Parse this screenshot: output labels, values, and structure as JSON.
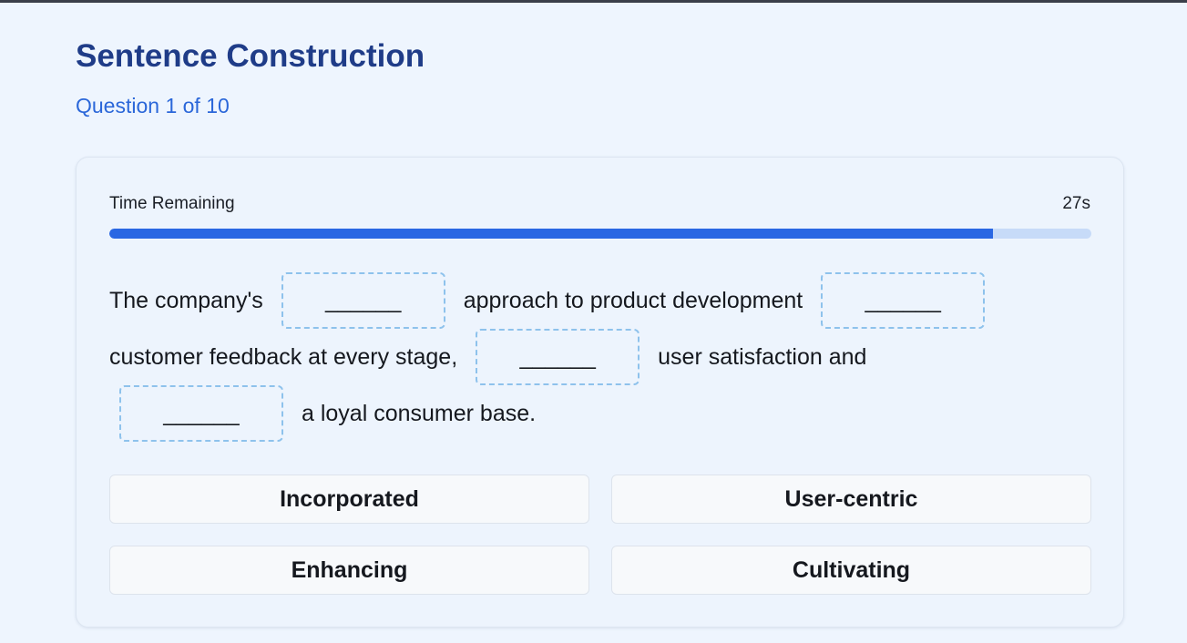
{
  "header": {
    "title": "Sentence Construction",
    "question_counter": "Question 1 of 10"
  },
  "timer": {
    "label": "Time Remaining",
    "value": "27s",
    "remaining_fraction": 0.9
  },
  "sentence": {
    "segments": [
      "The company's",
      "approach to product development",
      "customer feedback at every stage,",
      "user satisfaction and",
      "a loyal consumer base."
    ],
    "blank_placeholder": "______"
  },
  "options": [
    "Incorporated",
    "User-centric",
    "Enhancing",
    "Cultivating"
  ],
  "colors": {
    "title": "#1f3c88",
    "accent": "#2a67e3",
    "track": "#c7dbf8",
    "blank_border": "#8ec2ec"
  }
}
